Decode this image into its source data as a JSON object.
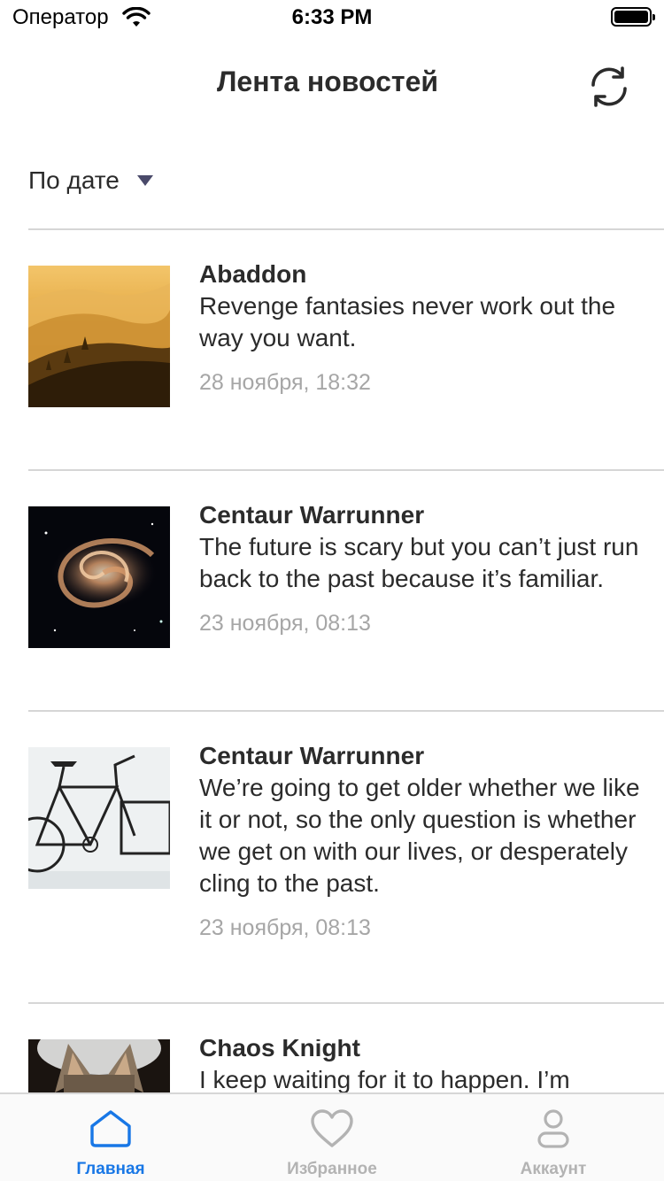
{
  "status_bar": {
    "carrier": "Оператор",
    "time": "6:33 PM"
  },
  "header": {
    "title": "Лента новостей",
    "refresh_icon": "refresh-icon"
  },
  "sort": {
    "label": "По дате"
  },
  "feed": [
    {
      "title": "Abaddon",
      "text": "Revenge fantasies never work out the way you want.",
      "date": "28 ноября, 18:32",
      "image": "sunset-hills"
    },
    {
      "title": "Centaur Warrunner",
      "text": "The future is scary but you can’t just run back to the past because it’s familiar.",
      "date": "23 ноября, 08:13",
      "image": "spiral-galaxy"
    },
    {
      "title": "Centaur Warrunner",
      "text": "We’re going to get older whether we like it or not, so the only question is whether we get on with our lives, or desperately cling to the past.",
      "date": "23 ноября, 08:13",
      "image": "bicycle-sketch"
    },
    {
      "title": "Chaos Knight",
      "text": "I keep waiting for it to happen. I’m",
      "date": "",
      "image": "cat"
    }
  ],
  "tabs": [
    {
      "label": "Главная",
      "icon": "home-icon",
      "active": true
    },
    {
      "label": "Избранное",
      "icon": "heart-icon",
      "active": false
    },
    {
      "label": "Аккаунт",
      "icon": "user-icon",
      "active": false
    }
  ],
  "colors": {
    "accent": "#1877e6",
    "inactive": "#b3b3b3",
    "date": "#a6a6a6",
    "divider": "#d6d6d6"
  }
}
